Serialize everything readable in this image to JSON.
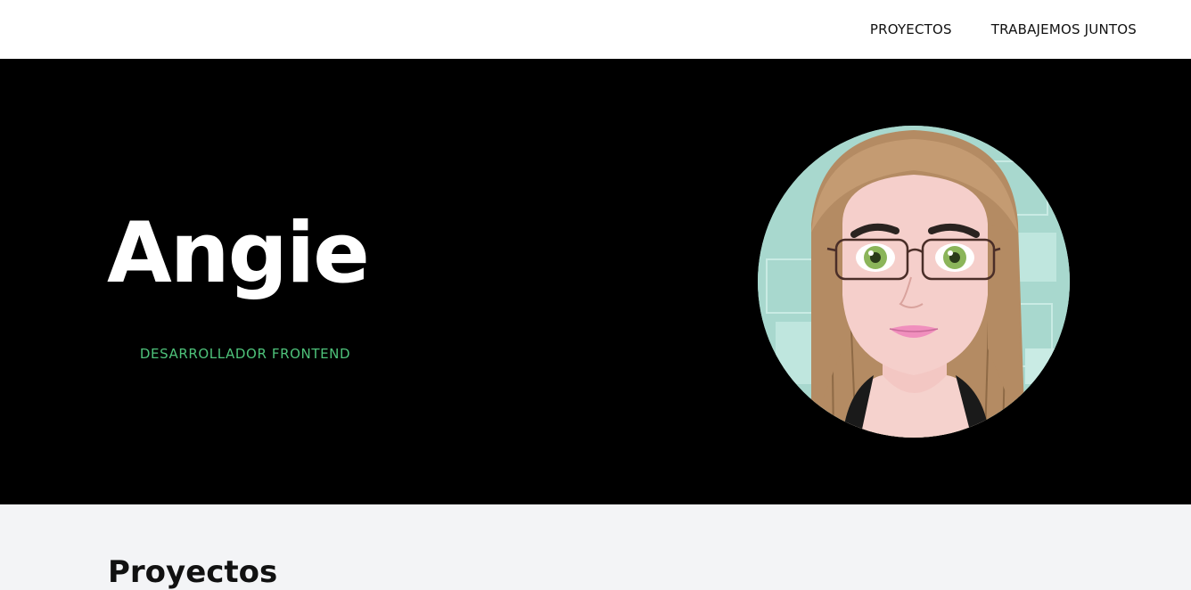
{
  "nav": {
    "items": [
      {
        "label": "PROYECTOS"
      },
      {
        "label": "TRABAJEMOS JUNTOS"
      }
    ]
  },
  "hero": {
    "name": "Angie",
    "role": "DESARROLLADOR FRONTEND",
    "avatar_icon": "avatar-illustration"
  },
  "projects": {
    "title": "Proyectos"
  },
  "colors": {
    "hero_background": "#000000",
    "role_accent": "#4ec27a",
    "page_background": "#f3f4f6",
    "avatar_background": "#a8d8ce"
  }
}
